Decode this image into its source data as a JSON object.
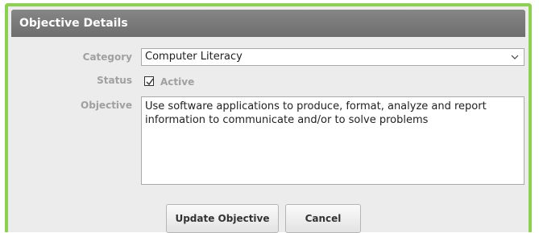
{
  "panel": {
    "title": "Objective Details"
  },
  "form": {
    "category_label": "Category",
    "category_value": "Computer Literacy",
    "status_label": "Status",
    "status_checked": true,
    "status_option_label": "Active",
    "objective_label": "Objective",
    "objective_value": "Use software applications to produce, format, analyze and report information to communicate and/or to solve problems"
  },
  "buttons": {
    "update_label": "Update Objective",
    "cancel_label": "Cancel"
  },
  "colors": {
    "frame_accent": "#8bd04e",
    "header_bg": "#7a7a7a",
    "label_text": "#a0a0a0"
  }
}
